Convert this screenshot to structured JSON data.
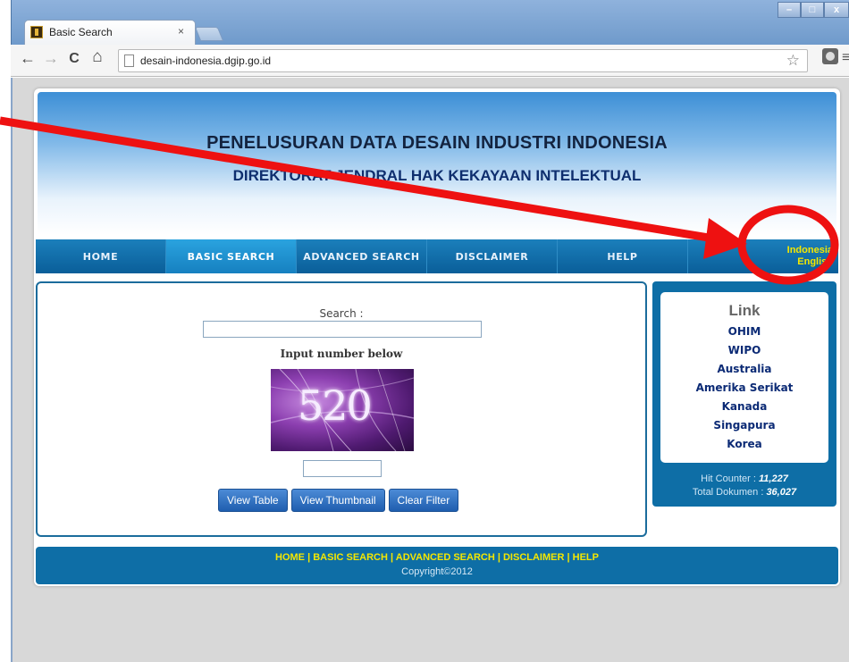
{
  "browser": {
    "tab_title": "Basic Search",
    "tab_close": "×",
    "url": "desain-indonesia.dgip.go.id",
    "back": "←",
    "forward": "→",
    "reload": "C",
    "home": "⌂",
    "star": "☆",
    "menu": "≡",
    "win_minimize": "–",
    "win_maximize": "□",
    "win_close": "x"
  },
  "banner": {
    "title": "PENELUSURAN DATA DESAIN INDUSTRI INDONESIA",
    "subtitle": "DIREKTORAT JENDRAL HAK KEKAYAAN INTELEKTUAL"
  },
  "nav": {
    "items": [
      "HOME",
      "BASIC SEARCH",
      "ADVANCED SEARCH",
      "DISCLAIMER",
      "HELP"
    ],
    "active": "BASIC SEARCH",
    "lang_indonesia": "Indonesia",
    "lang_english": "English"
  },
  "search": {
    "label": "Search :",
    "value": "",
    "captcha_label": "Input number below",
    "captcha_number": "520",
    "captcha_value": "",
    "buttons": {
      "view_table": "View Table",
      "view_thumbnail": "View Thumbnail",
      "clear_filter": "Clear Filter"
    }
  },
  "sidebar": {
    "title": "Link",
    "links": [
      "OHIM",
      "WIPO",
      "Australia",
      "Amerika Serikat",
      "Kanada",
      "Singapura",
      "Korea"
    ],
    "hit_counter_label": "Hit Counter :",
    "hit_counter_value": "11,227",
    "total_dokumen_label": "Total Dokumen :",
    "total_dokumen_value": "36,027"
  },
  "footer": {
    "links": [
      "HOME",
      "BASIC SEARCH",
      "ADVANCED SEARCH",
      "DISCLAIMER",
      "HELP"
    ],
    "separator": " | ",
    "copyright": "Copyright©2012"
  },
  "annotation": {
    "color": "#ee1111"
  }
}
